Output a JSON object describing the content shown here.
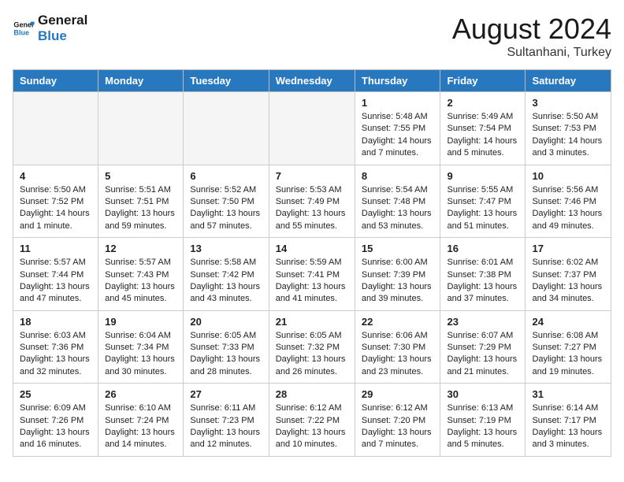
{
  "header": {
    "logo_line1": "General",
    "logo_line2": "Blue",
    "month_title": "August 2024",
    "location": "Sultanhani, Turkey"
  },
  "days_of_week": [
    "Sunday",
    "Monday",
    "Tuesday",
    "Wednesday",
    "Thursday",
    "Friday",
    "Saturday"
  ],
  "weeks": [
    [
      {
        "day": "",
        "info": ""
      },
      {
        "day": "",
        "info": ""
      },
      {
        "day": "",
        "info": ""
      },
      {
        "day": "",
        "info": ""
      },
      {
        "day": "1",
        "info": "Sunrise: 5:48 AM\nSunset: 7:55 PM\nDaylight: 14 hours\nand 7 minutes."
      },
      {
        "day": "2",
        "info": "Sunrise: 5:49 AM\nSunset: 7:54 PM\nDaylight: 14 hours\nand 5 minutes."
      },
      {
        "day": "3",
        "info": "Sunrise: 5:50 AM\nSunset: 7:53 PM\nDaylight: 14 hours\nand 3 minutes."
      }
    ],
    [
      {
        "day": "4",
        "info": "Sunrise: 5:50 AM\nSunset: 7:52 PM\nDaylight: 14 hours\nand 1 minute."
      },
      {
        "day": "5",
        "info": "Sunrise: 5:51 AM\nSunset: 7:51 PM\nDaylight: 13 hours\nand 59 minutes."
      },
      {
        "day": "6",
        "info": "Sunrise: 5:52 AM\nSunset: 7:50 PM\nDaylight: 13 hours\nand 57 minutes."
      },
      {
        "day": "7",
        "info": "Sunrise: 5:53 AM\nSunset: 7:49 PM\nDaylight: 13 hours\nand 55 minutes."
      },
      {
        "day": "8",
        "info": "Sunrise: 5:54 AM\nSunset: 7:48 PM\nDaylight: 13 hours\nand 53 minutes."
      },
      {
        "day": "9",
        "info": "Sunrise: 5:55 AM\nSunset: 7:47 PM\nDaylight: 13 hours\nand 51 minutes."
      },
      {
        "day": "10",
        "info": "Sunrise: 5:56 AM\nSunset: 7:46 PM\nDaylight: 13 hours\nand 49 minutes."
      }
    ],
    [
      {
        "day": "11",
        "info": "Sunrise: 5:57 AM\nSunset: 7:44 PM\nDaylight: 13 hours\nand 47 minutes."
      },
      {
        "day": "12",
        "info": "Sunrise: 5:57 AM\nSunset: 7:43 PM\nDaylight: 13 hours\nand 45 minutes."
      },
      {
        "day": "13",
        "info": "Sunrise: 5:58 AM\nSunset: 7:42 PM\nDaylight: 13 hours\nand 43 minutes."
      },
      {
        "day": "14",
        "info": "Sunrise: 5:59 AM\nSunset: 7:41 PM\nDaylight: 13 hours\nand 41 minutes."
      },
      {
        "day": "15",
        "info": "Sunrise: 6:00 AM\nSunset: 7:39 PM\nDaylight: 13 hours\nand 39 minutes."
      },
      {
        "day": "16",
        "info": "Sunrise: 6:01 AM\nSunset: 7:38 PM\nDaylight: 13 hours\nand 37 minutes."
      },
      {
        "day": "17",
        "info": "Sunrise: 6:02 AM\nSunset: 7:37 PM\nDaylight: 13 hours\nand 34 minutes."
      }
    ],
    [
      {
        "day": "18",
        "info": "Sunrise: 6:03 AM\nSunset: 7:36 PM\nDaylight: 13 hours\nand 32 minutes."
      },
      {
        "day": "19",
        "info": "Sunrise: 6:04 AM\nSunset: 7:34 PM\nDaylight: 13 hours\nand 30 minutes."
      },
      {
        "day": "20",
        "info": "Sunrise: 6:05 AM\nSunset: 7:33 PM\nDaylight: 13 hours\nand 28 minutes."
      },
      {
        "day": "21",
        "info": "Sunrise: 6:05 AM\nSunset: 7:32 PM\nDaylight: 13 hours\nand 26 minutes."
      },
      {
        "day": "22",
        "info": "Sunrise: 6:06 AM\nSunset: 7:30 PM\nDaylight: 13 hours\nand 23 minutes."
      },
      {
        "day": "23",
        "info": "Sunrise: 6:07 AM\nSunset: 7:29 PM\nDaylight: 13 hours\nand 21 minutes."
      },
      {
        "day": "24",
        "info": "Sunrise: 6:08 AM\nSunset: 7:27 PM\nDaylight: 13 hours\nand 19 minutes."
      }
    ],
    [
      {
        "day": "25",
        "info": "Sunrise: 6:09 AM\nSunset: 7:26 PM\nDaylight: 13 hours\nand 16 minutes."
      },
      {
        "day": "26",
        "info": "Sunrise: 6:10 AM\nSunset: 7:24 PM\nDaylight: 13 hours\nand 14 minutes."
      },
      {
        "day": "27",
        "info": "Sunrise: 6:11 AM\nSunset: 7:23 PM\nDaylight: 13 hours\nand 12 minutes."
      },
      {
        "day": "28",
        "info": "Sunrise: 6:12 AM\nSunset: 7:22 PM\nDaylight: 13 hours\nand 10 minutes."
      },
      {
        "day": "29",
        "info": "Sunrise: 6:12 AM\nSunset: 7:20 PM\nDaylight: 13 hours\nand 7 minutes."
      },
      {
        "day": "30",
        "info": "Sunrise: 6:13 AM\nSunset: 7:19 PM\nDaylight: 13 hours\nand 5 minutes."
      },
      {
        "day": "31",
        "info": "Sunrise: 6:14 AM\nSunset: 7:17 PM\nDaylight: 13 hours\nand 3 minutes."
      }
    ]
  ]
}
